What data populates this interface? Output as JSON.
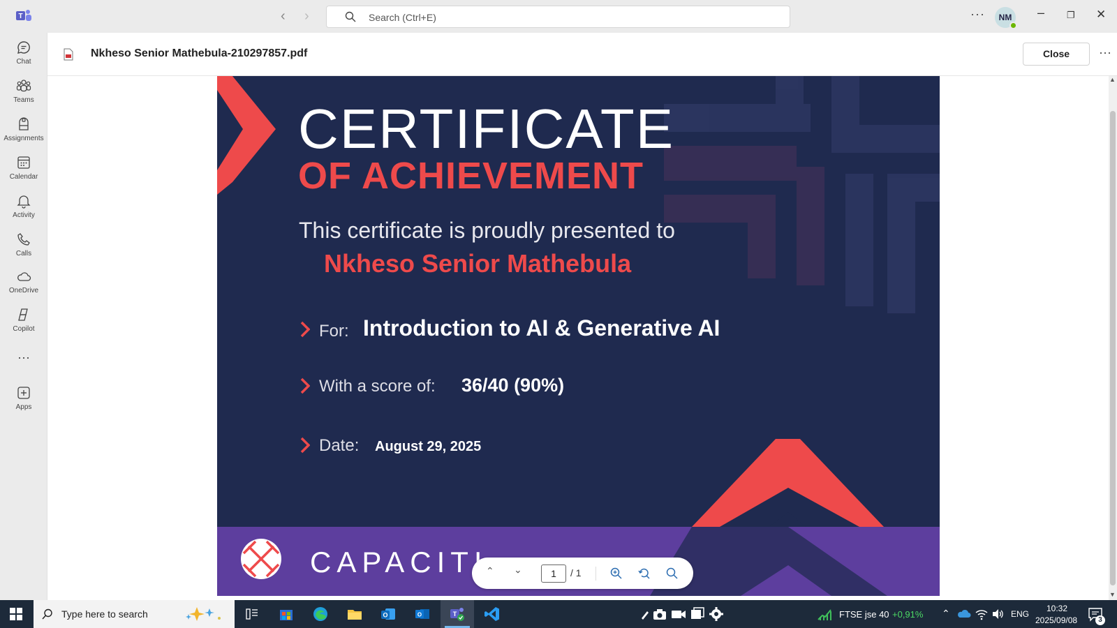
{
  "titlebar": {
    "search_placeholder": "Search (Ctrl+E)",
    "avatar_initials": "NM"
  },
  "rail": [
    {
      "label": "Chat"
    },
    {
      "label": "Teams"
    },
    {
      "label": "Assignments"
    },
    {
      "label": "Calendar"
    },
    {
      "label": "Activity"
    },
    {
      "label": "Calls"
    },
    {
      "label": "OneDrive"
    },
    {
      "label": "Copilot"
    },
    {
      "label": "Apps"
    }
  ],
  "document": {
    "title": "Nkheso Senior Mathebula-210297857.pdf",
    "close_label": "Close"
  },
  "certificate": {
    "title_line1": "CERTIFICATE",
    "title_line2": "OF ACHIEVEMENT",
    "presented_text": "This certificate is proudly presented to",
    "recipient": "Nkheso Senior Mathebula",
    "for_label": "For:",
    "for_value": "Introduction to AI & Generative AI",
    "score_label": "With a score of:",
    "score_value": "36/40 (90%)",
    "date_label": "Date:",
    "date_value": "August 29, 2025",
    "brand": "CAPACITI"
  },
  "pager": {
    "current_page": "1",
    "total": "/ 1"
  },
  "taskbar": {
    "search_placeholder": "Type here to search",
    "ticker": "FTSE jse 40",
    "ticker_change": "+0,91%",
    "language": "ENG",
    "time": "10:32",
    "date": "2025/09/08",
    "notification_count": "3"
  },
  "colors": {
    "cert_navy": "#1f2a4f",
    "cert_red": "#ee4a4b",
    "cert_purple": "#5d3e9e",
    "teams_purple": "#5b5fc7"
  }
}
